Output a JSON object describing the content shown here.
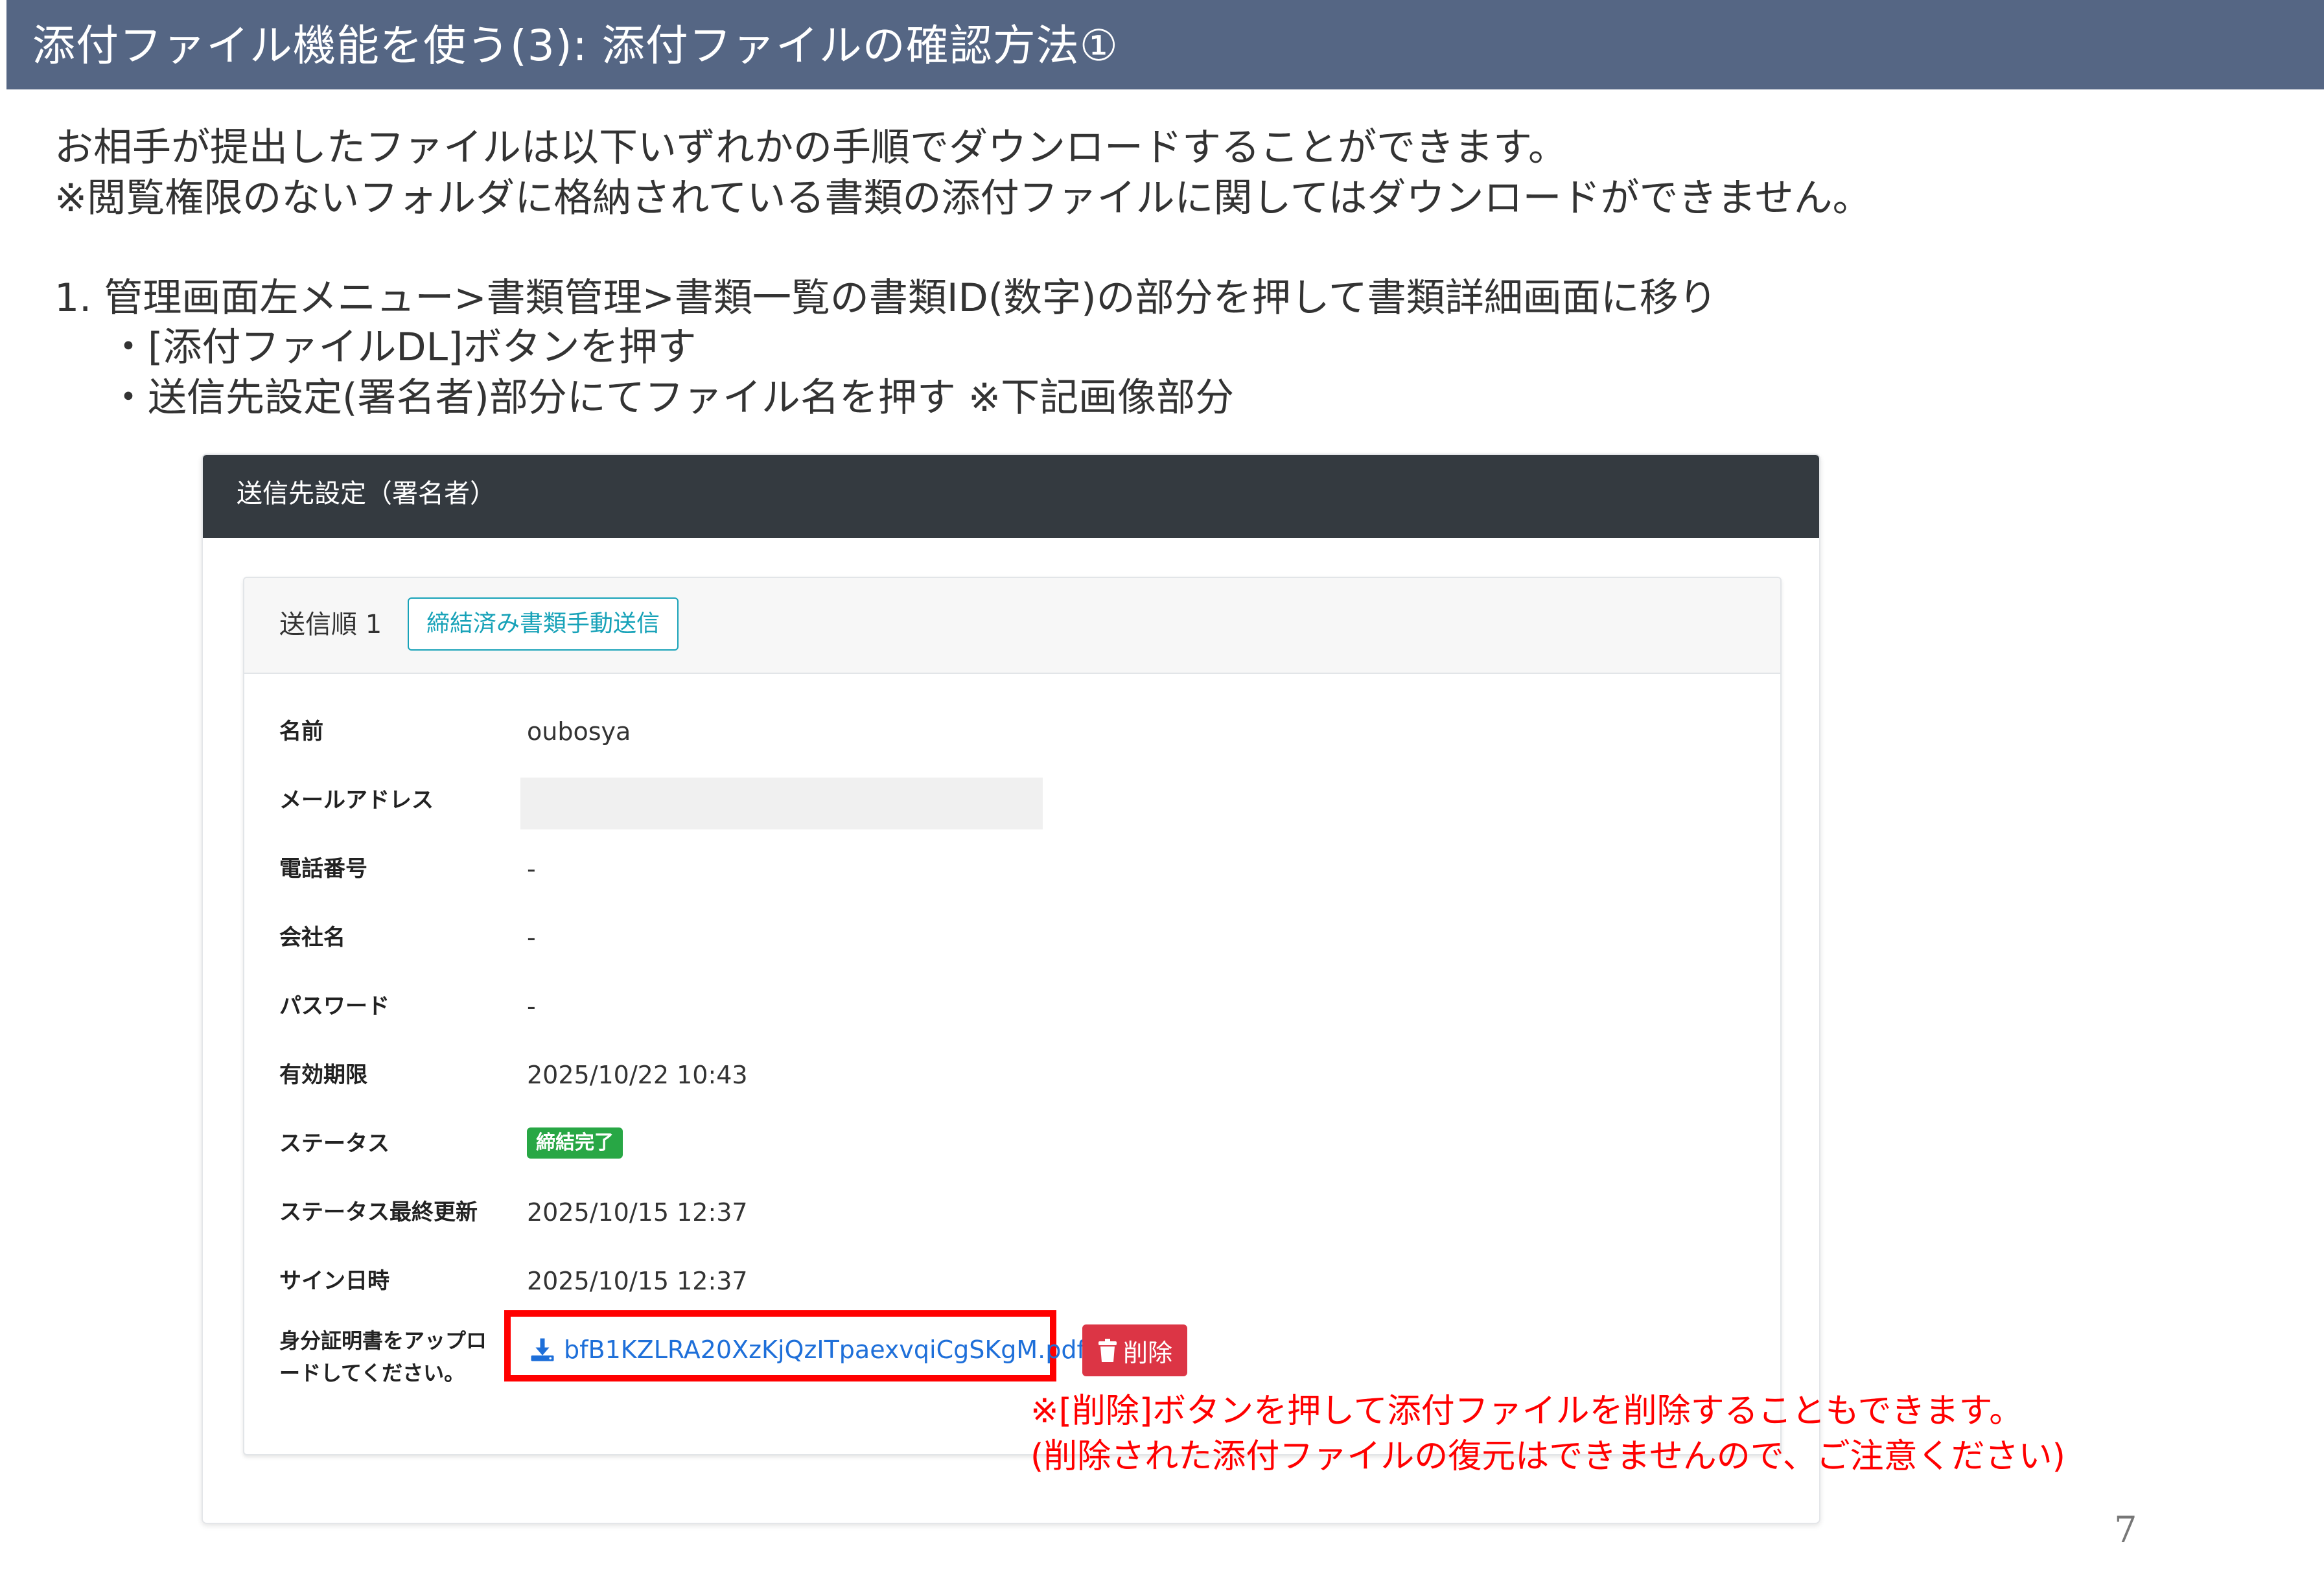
{
  "header": {
    "title": "添付ファイル機能を使う(3): 添付ファイルの確認方法①"
  },
  "intro": {
    "line1": "お相手が提出したファイルは以下いずれかの手順でダウンロードすることができます。",
    "line2": "※閲覧権限のないフォルダに格納されている書類の添付ファイルに関してはダウンロードができません。"
  },
  "steps": {
    "step1": "1. 管理画面左メニュー>書類管理>書類一覧の書類ID(数字)の部分を押して書類詳細画面に移り",
    "bullet1": "・[添付ファイルDL]ボタンを押す",
    "bullet2": "・送信先設定(署名者)部分にてファイル名を押す ※下記画像部分"
  },
  "screenshot": {
    "panel_title": "送信先設定（署名者）",
    "card_header": {
      "order_label": "送信順 1",
      "manual_send_label": "締結済み書類手動送信"
    },
    "rows": [
      {
        "label": "名前",
        "value": "oubosya"
      },
      {
        "label": "メールアドレス",
        "value": ""
      },
      {
        "label": "電話番号",
        "value": "-"
      },
      {
        "label": "会社名",
        "value": "-"
      },
      {
        "label": "パスワード",
        "value": "-"
      },
      {
        "label": "有効期限",
        "value": "2025/10/22 10:43"
      },
      {
        "label": "ステータス",
        "value": "締結完了"
      },
      {
        "label": "ステータス最終更新",
        "value": "2025/10/15 12:37"
      },
      {
        "label": "サイン日時",
        "value": "2025/10/15 12:37"
      }
    ],
    "upload": {
      "label_line1": "身分証明書をアップロ",
      "label_line2": "ードしてください。",
      "file_name": "bfB1KZLRA20XzKjQzITpaexvqiCgSKgM.pdf",
      "delete_label": "削除"
    },
    "colors": {
      "header_dark": "#343a40",
      "status_success": "#28a745",
      "delete_danger": "#dc3545",
      "link_blue": "#1e6fd9",
      "accent_teal": "#17a2b8"
    }
  },
  "note": {
    "line1": "※[削除]ボタンを押して添付ファイルを削除することもできます。",
    "line2": "(削除された添付ファイルの復元はできませんので、ご注意ください)"
  },
  "page_number": "7",
  "slide_colors": {
    "title_bar": "#556684",
    "note_red": "#ff0000"
  }
}
